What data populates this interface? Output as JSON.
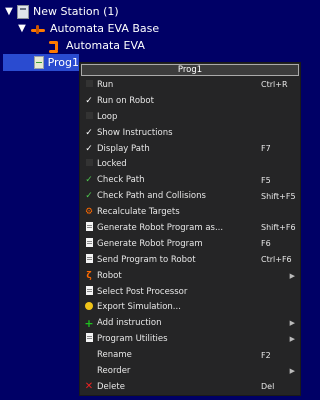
{
  "tree": {
    "station": "New Station (1)",
    "robot_base": "Automata EVA Base",
    "robot": "Automata EVA",
    "program": "Prog1"
  },
  "menu": {
    "title": "Prog1",
    "items": [
      {
        "label": "Run",
        "shortcut": "Ctrl+R",
        "icon": "box-icon"
      },
      {
        "label": "Run on Robot",
        "shortcut": "",
        "icon": "checkmark-icon"
      },
      {
        "label": "Loop",
        "shortcut": "",
        "icon": "box-icon"
      },
      {
        "label": "Show Instructions",
        "shortcut": "",
        "icon": "checkmark-icon"
      },
      {
        "label": "Display Path",
        "shortcut": "F7",
        "icon": "checkmark-icon"
      },
      {
        "label": "Locked",
        "shortcut": "",
        "icon": "box-icon"
      },
      {
        "label": "Check Path",
        "shortcut": "F5",
        "icon": "green-check-icon"
      },
      {
        "label": "Check Path and Collisions",
        "shortcut": "Shift+F5",
        "icon": "green-check-icon"
      },
      {
        "label": "Recalculate Targets",
        "shortcut": "",
        "icon": "robot-target-icon"
      },
      {
        "label": "Generate Robot Program as...",
        "shortcut": "Shift+F6",
        "icon": "document-icon"
      },
      {
        "label": "Generate Robot Program",
        "shortcut": "F6",
        "icon": "document-icon"
      },
      {
        "label": "Send Program to Robot",
        "shortcut": "Ctrl+F6",
        "icon": "document-icon"
      },
      {
        "label": "Robot",
        "shortcut": "",
        "icon": "robot-icon",
        "submenu": true
      },
      {
        "label": "Select Post Processor",
        "shortcut": "",
        "icon": "document-icon"
      },
      {
        "label": "Export Simulation...",
        "shortcut": "",
        "icon": "lightbulb-icon"
      },
      {
        "label": "Add instruction",
        "shortcut": "",
        "icon": "plus-icon",
        "submenu": true
      },
      {
        "label": "Program Utilities",
        "shortcut": "",
        "icon": "document-icon",
        "submenu": true
      },
      {
        "label": "Rename",
        "shortcut": "F2",
        "icon": ""
      },
      {
        "label": "Reorder",
        "shortcut": "",
        "icon": "",
        "submenu": true
      },
      {
        "label": "Delete",
        "shortcut": "Del",
        "icon": "delete-icon"
      }
    ]
  },
  "colors": {
    "background": "#000066",
    "menu_background": "#252526",
    "check_green": "#4ec94e",
    "robot_orange": "#ff7a00",
    "delete_red": "#ee2222"
  }
}
